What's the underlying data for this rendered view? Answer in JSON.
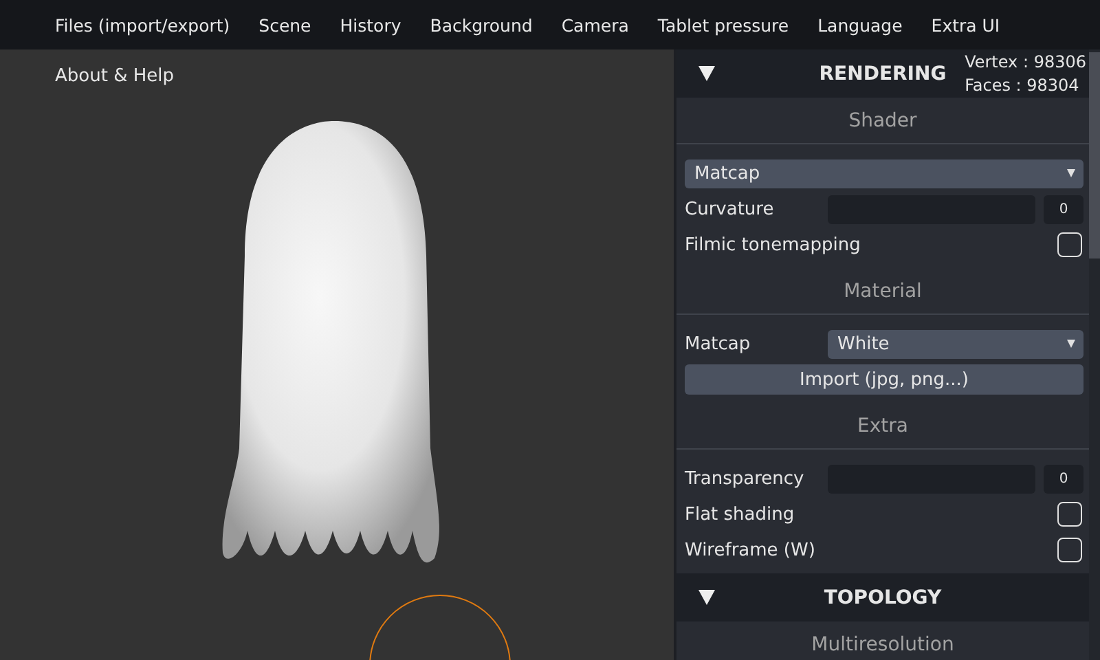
{
  "menu": [
    "Files (import/export)",
    "Scene",
    "History",
    "Background",
    "Camera",
    "Tablet pressure",
    "Language",
    "Extra UI"
  ],
  "menu_overflow": [
    "About & Help"
  ],
  "stats": {
    "vertex": "Vertex : 98306",
    "faces": "Faces : 98304"
  },
  "sections": [
    {
      "title": "RENDERING",
      "expanded": true,
      "groups": [
        {
          "title": "Shader",
          "controls": [
            {
              "kind": "select",
              "value": "Matcap"
            },
            {
              "kind": "slider",
              "label": "Curvature",
              "level": 0,
              "reading": "0"
            },
            {
              "kind": "checkbox",
              "label": "Filmic tonemapping",
              "checked": false
            }
          ]
        },
        {
          "title": "Material",
          "controls": [
            {
              "kind": "select",
              "label": "Matcap",
              "value": "White"
            },
            {
              "kind": "button",
              "label": "Import (jpg, png...)"
            }
          ]
        },
        {
          "title": "Extra",
          "controls": [
            {
              "kind": "slider",
              "label": "Transparency",
              "level": 0,
              "reading": "0"
            },
            {
              "kind": "checkbox",
              "label": "Flat shading",
              "checked": false
            },
            {
              "kind": "checkbox",
              "label": "Wireframe (W)",
              "checked": false
            }
          ]
        }
      ]
    },
    {
      "title": "TOPOLOGY",
      "expanded": true,
      "groups": [
        {
          "title": "Multiresolution"
        }
      ]
    }
  ]
}
